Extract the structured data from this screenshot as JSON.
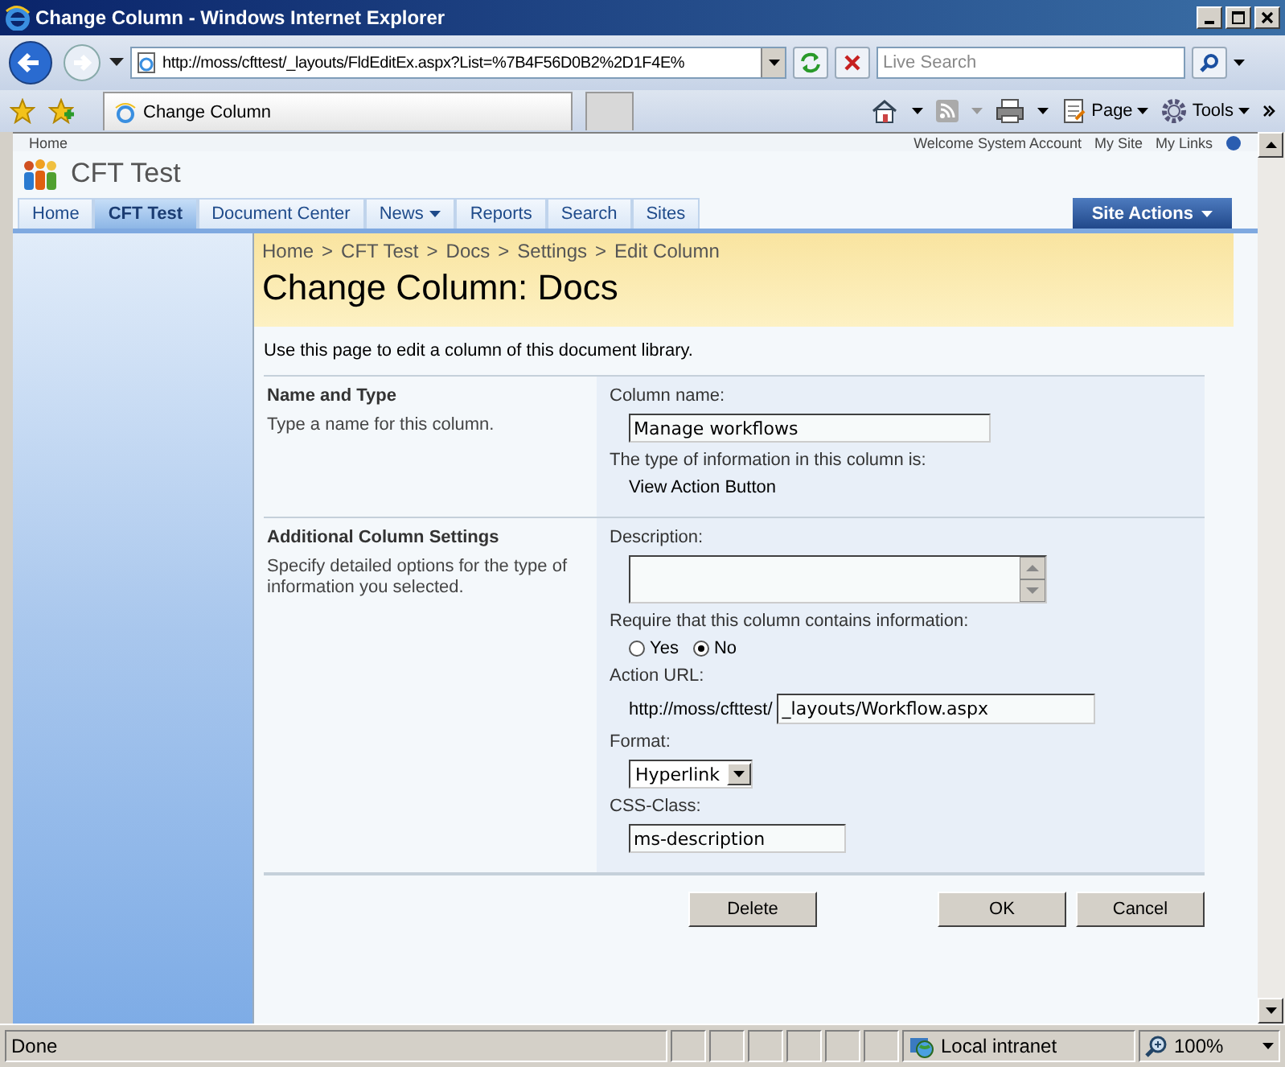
{
  "window": {
    "title": "Change Column - Windows Internet Explorer"
  },
  "address_bar": {
    "url": "http://moss/cfttest/_layouts/FldEditEx.aspx?List=%7B4F56D0B2%2D1F4E%",
    "search_placeholder": "Live Search"
  },
  "browser_tab": {
    "title": "Change Column"
  },
  "command_bar": {
    "items": [
      "Page",
      "Tools"
    ]
  },
  "top_links": {
    "home": "Home",
    "welcome": "Welcome System Account",
    "links": [
      "My Site",
      "My Links"
    ]
  },
  "site": {
    "title": "CFT Test"
  },
  "nav_tabs": [
    {
      "label": "Home",
      "selected": false,
      "dropdown": false
    },
    {
      "label": "CFT Test",
      "selected": true,
      "dropdown": false
    },
    {
      "label": "Document Center",
      "selected": false,
      "dropdown": false
    },
    {
      "label": "News",
      "selected": false,
      "dropdown": true
    },
    {
      "label": "Reports",
      "selected": false,
      "dropdown": false
    },
    {
      "label": "Search",
      "selected": false,
      "dropdown": false
    },
    {
      "label": "Sites",
      "selected": false,
      "dropdown": false
    }
  ],
  "site_actions": "Site Actions",
  "breadcrumb": {
    "separator": ">",
    "items": [
      "Home",
      "CFT Test",
      "Docs",
      "Settings",
      "Edit Column"
    ]
  },
  "page_title": "Change Column: Docs",
  "intro": "Use this page to edit a column of this document library.",
  "sections": [
    {
      "title": "Name and Type",
      "description": "Type a name for this column.",
      "fields": [
        {
          "kind": "text",
          "label": "Column name:",
          "value": "Manage workflows"
        },
        {
          "kind": "info",
          "label": "The type of information in this column is:",
          "value": "View Action Button"
        }
      ]
    },
    {
      "title": "Additional Column Settings",
      "description": "Specify detailed options for the type of information you selected.",
      "fields": [
        {
          "kind": "textarea",
          "label": "Description:"
        },
        {
          "kind": "radio",
          "label": "Require that this column contains information:",
          "options": [
            {
              "label": "Yes",
              "selected": false
            },
            {
              "label": "No",
              "selected": true
            }
          ]
        },
        {
          "kind": "url",
          "label": "Action URL:",
          "prefix": "http://moss/cfttest/",
          "value": "_layouts/Workflow.aspx"
        },
        {
          "kind": "select",
          "label": "Format:",
          "value": "Hyperlink"
        },
        {
          "kind": "short",
          "label": "CSS-Class:",
          "value": "ms-description"
        }
      ]
    }
  ],
  "buttons_left": [
    "Delete"
  ],
  "buttons_right": [
    "OK",
    "Cancel"
  ],
  "status_bar": {
    "text": "Done",
    "zone": "Local intranet",
    "zoom": "100%"
  }
}
